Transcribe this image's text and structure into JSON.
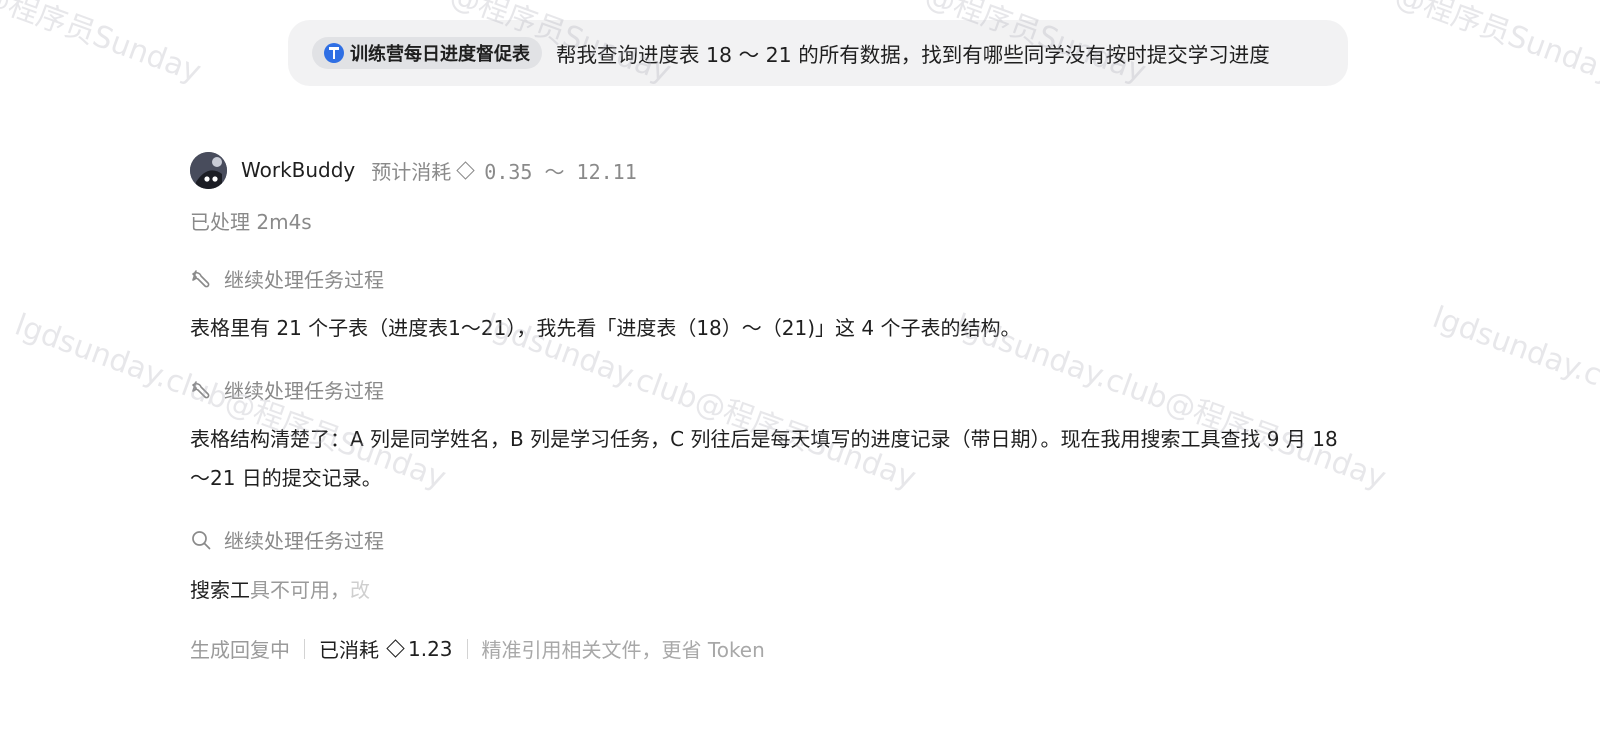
{
  "user_message": {
    "tag": "训练营每日进度督促表",
    "text": "帮我查询进度表 18 ～ 21 的所有数据，找到有哪些同学没有按时提交学习进度"
  },
  "assistant": {
    "name": "WorkBuddy",
    "cost_label": "预计消耗",
    "cost_range": "0.35 ～ 12.11",
    "processed": "已处理 2m4s",
    "steps": [
      {
        "label": "继续处理任务过程",
        "icon": "tool-icon"
      },
      {
        "label": "继续处理任务过程",
        "icon": "tool-icon"
      },
      {
        "label": "继续处理任务过程",
        "icon": "search-icon"
      }
    ],
    "paragraphs": [
      "表格里有 21 个子表（进度表1～21），我先看「进度表（18）～（21)」这 4 个子表的结构。",
      "表格结构清楚了：A 列是同学姓名，B 列是学习任务，C 列往后是每天填写的进度记录（带日期）。现在我用搜索工具查找 9 月 18～21 日的提交记录。"
    ],
    "partial": {
      "solid": "搜索工",
      "fade1": "具不可用，",
      "fade2": "改"
    }
  },
  "footer": {
    "status": "生成回复中",
    "used_label": "已消耗",
    "used_value": "1.23",
    "hint": "精准引用相关文件，更省 Token"
  },
  "watermarks": [
    "@程序员Sunday",
    "@程序员Sunday",
    "@程序员Sunday",
    "@程序员Sunday",
    "lgdsunday.club@程序员Sunday",
    "lgdsunday.club@程序员Sunday",
    "lgdsunday.club@程序员Sunday",
    "lgdsunday.c"
  ]
}
